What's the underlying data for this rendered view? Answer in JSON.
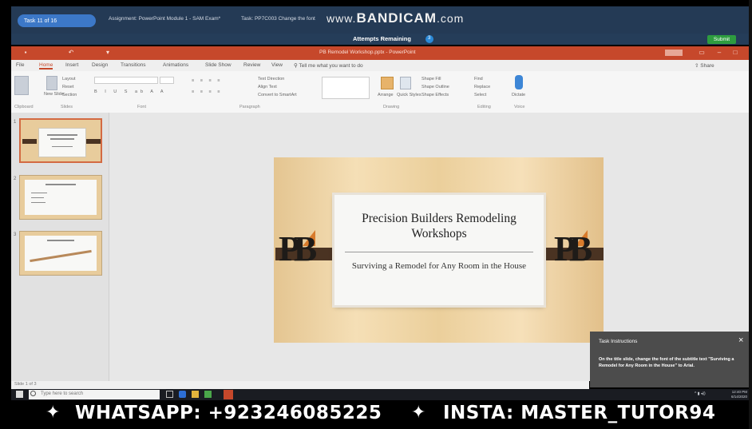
{
  "assessment": {
    "task_pill": "Task 11 of 16",
    "assignment_label": "Assignment: PowerPoint Module 1 - SAM Exam*",
    "task_label": "Task: PP7C003 Change the font",
    "watermark_prefix": "www.",
    "watermark_brand": "BANDICAM",
    "watermark_suffix": ".com",
    "attempts_label": "Attempts Remaining",
    "attempts_count": "3",
    "submit_label": "Submit"
  },
  "powerpoint": {
    "window_title": "PB Remodel Workshop.pptx - PowerPoint",
    "tabs": [
      "File",
      "Home",
      "Insert",
      "Design",
      "Transitions",
      "Animations",
      "Slide Show",
      "Review",
      "View",
      "Tell me what you want to do"
    ],
    "share_label": "Share",
    "groups": [
      "Clipboard",
      "Slides",
      "Font",
      "Paragraph",
      "Drawing",
      "Editing",
      "Voice"
    ],
    "ribbon_items": {
      "layout": "Layout",
      "reset": "Reset",
      "new_slide": "New Slide",
      "section": "Section",
      "text_direction": "Text Direction",
      "align_text": "Align Text",
      "convert_smartart": "Convert to SmartArt",
      "arrange": "Arrange",
      "quick_styles": "Quick Styles",
      "shape_fill": "Shape Fill",
      "shape_outline": "Shape Outline",
      "shape_effects": "Shape Effects",
      "find": "Find",
      "replace": "Replace",
      "select": "Select",
      "dictate": "Dictate"
    },
    "slides": [
      {
        "number": "1",
        "title": "Precision Builders Remodeling Workshops"
      },
      {
        "number": "2",
        "title": "Current Workshops"
      },
      {
        "number": "3",
        "title": "Remodel Timeline"
      }
    ],
    "slide_count_label": "Slide 1 of 3"
  },
  "slide": {
    "title": "Precision Builders Remodeling Workshops",
    "subtitle": "Surviving a Remodel for Any Room in the House"
  },
  "task_panel": {
    "heading": "Task Instructions",
    "close": "×",
    "body": "On the title slide, change the font of the subtitle text \"Surviving a Remodel for Any Room in the House\" to Arial."
  },
  "taskbar": {
    "search_placeholder": "Type here to search",
    "time": "12:40 PM",
    "date": "6/14/2020"
  },
  "social": {
    "whatsapp": "WHATSAPP: +923246085225",
    "insta": "INSTA: MASTER_TUTOR94"
  },
  "colors": {
    "ppt_red": "#c6482b",
    "assessment_bar": "#243a55",
    "submit_green": "#2e9c3f",
    "task_panel": "#4c4c4c"
  }
}
